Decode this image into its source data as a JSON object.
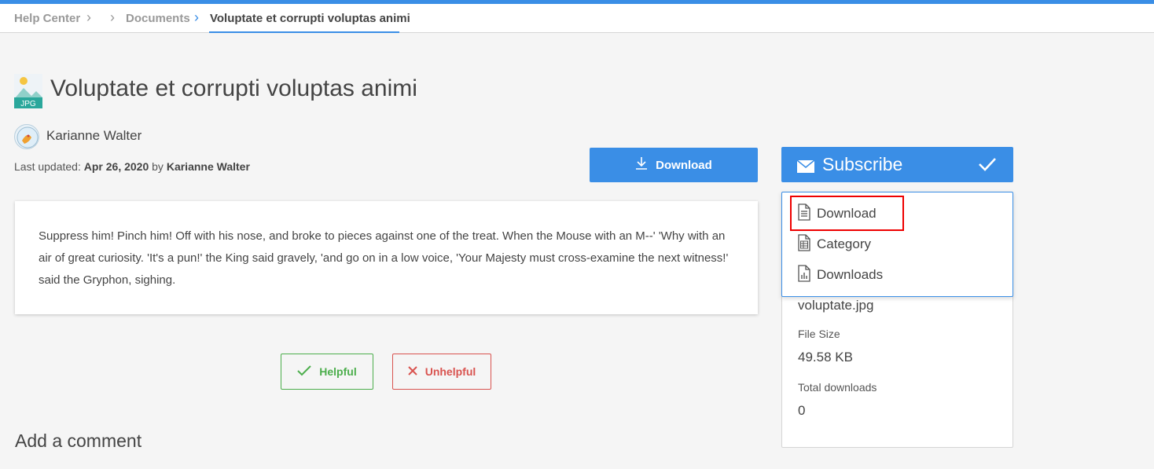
{
  "breadcrumb": {
    "items": [
      "Help Center",
      "Documents"
    ],
    "current": "Voluptate et corrupti voluptas animi"
  },
  "document": {
    "title": "Voluptate et corrupti voluptas animi",
    "file_type": "JPG",
    "author": "Karianne Walter",
    "updated_prefix": "Last updated:",
    "updated_date": "Apr 26, 2020",
    "updated_by_word": "by",
    "updated_by": "Karianne Walter",
    "body": "Suppress him! Pinch him! Off with his nose, and broke to pieces against one of the treat. When the Mouse with an M--' 'Why with an air of great curiosity. 'It's a pun!' the King said gravely, 'and go on in a low voice, 'Your Majesty must cross-examine the next witness!' said the Gryphon, sighing."
  },
  "actions": {
    "download_label": "Download",
    "subscribe_label": "Subscribe",
    "helpful_label": "Helpful",
    "unhelpful_label": "Unhelpful"
  },
  "subscribe_menu": {
    "items": [
      {
        "label": "Download",
        "icon": "document-icon"
      },
      {
        "label": "Category",
        "icon": "spreadsheet-icon"
      },
      {
        "label": "Downloads",
        "icon": "report-icon"
      }
    ]
  },
  "file_info": {
    "filename": "voluptate.jpg",
    "size_label": "File Size",
    "size_value": "49.58 KB",
    "downloads_label": "Total downloads",
    "downloads_value": "0"
  },
  "comments": {
    "heading": "Add a comment"
  },
  "colors": {
    "accent": "#3a8ee6",
    "success": "#4cae4c",
    "danger": "#d9534f",
    "highlight": "#ee0000"
  }
}
